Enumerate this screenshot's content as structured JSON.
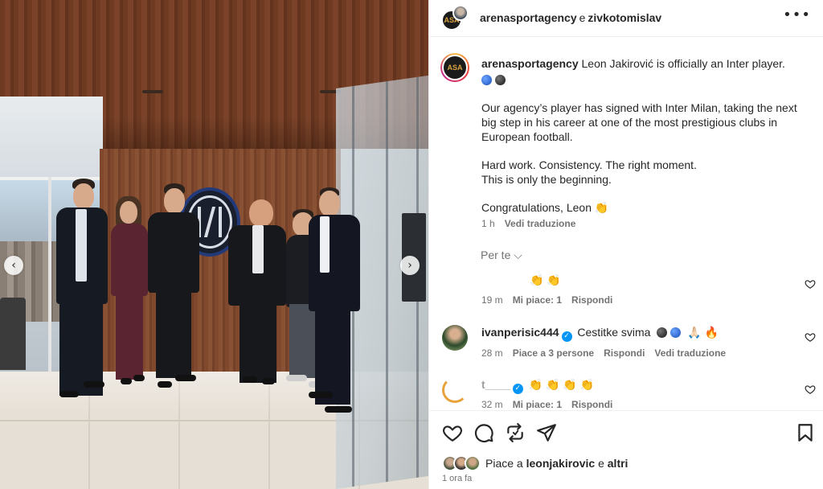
{
  "post": {
    "header": {
      "author": "arenasportagency",
      "conjunction": "e",
      "coauthor": "zivkotomislav",
      "avatar_text": "ASA"
    },
    "caption": {
      "author": "arenasportagency",
      "line1": "Leon Jakirović is officially an Inter player.",
      "para2": "Our agency’s player has signed with Inter Milan, taking the next big step in his career at one of the most prestigious clubs in European football.",
      "para3a": "Hard work. Consistency. The right moment.",
      "para3b": "This is only the beginning.",
      "para4": "Congratulations, Leon 👏",
      "time": "1 h",
      "translate": "Vedi traduzione"
    },
    "for_you": "Per te ⌵",
    "comments": [
      {
        "text": "👏 👏",
        "time": "19 m",
        "likes": "Mi piace: 1",
        "reply": "Rispondi"
      },
      {
        "user": "ivanperisic444",
        "verified_mark": "✓",
        "text": "Cestitke svima",
        "emojis": "🙏🏻 🔥",
        "time": "28 m",
        "likes": "Piace a 3 persone",
        "reply": "Rispondi",
        "translate": "Vedi traduzione"
      },
      {
        "user": "t____",
        "verified_mark": "✓",
        "text": "👏 👏 👏 👏",
        "time": "32 m",
        "likes": "Mi piace: 1",
        "reply": "Rispondi"
      }
    ],
    "likes": {
      "prefix": "Piace a",
      "user": "leonjakirovic",
      "suffix": "e",
      "others": "altri"
    },
    "posted": "1 ora fa"
  },
  "photo": {
    "prev_arrow": "‹",
    "next_arrow": "›"
  },
  "colors": {
    "accent_blue": "#0095f6",
    "meta_gray": "#737373",
    "text": "#262626"
  },
  "icons": [
    "heart-icon",
    "comment-icon",
    "share-icon",
    "send-icon",
    "bookmark-icon",
    "more-options-icon",
    "verified-badge-icon"
  ]
}
